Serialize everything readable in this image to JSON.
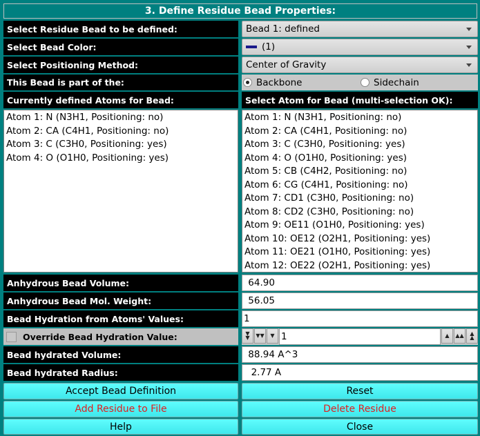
{
  "title": "3. Define Residue Bead Properties:",
  "rows": {
    "select_bead": {
      "label": "Select Residue Bead to be defined:",
      "value": "Bead 1: defined"
    },
    "select_color": {
      "label": "Select Bead Color:",
      "value": "(1)",
      "swatch_color": "#1a1a8a"
    },
    "select_positioning": {
      "label": "Select Positioning Method:",
      "value": "Center of Gravity"
    },
    "part_of": {
      "label": "This Bead is part of the:",
      "options": [
        "Backbone",
        "Sidechain"
      ],
      "selected": "Backbone"
    }
  },
  "defined_atoms": {
    "header": "Currently defined Atoms for Bead:",
    "items": [
      "Atom 1: N (N3H1, Positioning: no)",
      "Atom 2: CA (C4H1, Positioning: no)",
      "Atom 3: C (C3H0, Positioning: yes)",
      "Atom 4: O (O1H0, Positioning: yes)"
    ]
  },
  "select_atoms": {
    "header": "Select Atom for Bead (multi-selection OK):",
    "items": [
      "Atom 1: N (N3H1, Positioning: no)",
      "Atom 2: CA (C4H1, Positioning: no)",
      "Atom 3: C (C3H0, Positioning: yes)",
      "Atom 4: O (O1H0, Positioning: yes)",
      "Atom 5: CB (C4H2, Positioning: no)",
      "Atom 6: CG (C4H1, Positioning: no)",
      "Atom 7: CD1 (C3H0, Positioning: no)",
      "Atom 8: CD2 (C3H0, Positioning: no)",
      "Atom 9: OE11 (O1H0, Positioning: yes)",
      "Atom 10: OE12 (O2H1, Positioning: yes)",
      "Atom 11: OE21 (O1H0, Positioning: yes)",
      "Atom 12: OE22 (O2H1, Positioning: yes)"
    ]
  },
  "properties": {
    "anhydrous_volume": {
      "label": "Anhydrous Bead Volume:",
      "value": " 64.90"
    },
    "anhydrous_mw": {
      "label": "Anhydrous Bead Mol. Weight:",
      "value": " 56.05"
    },
    "hydration_atoms": {
      "label": "Bead Hydration from Atoms' Values:",
      "value": "1"
    },
    "override_hydration": {
      "label": "Override Bead Hydration Value:",
      "value": "1",
      "checked": false
    },
    "hydrated_volume": {
      "label": "Bead hydrated Volume:",
      "value": " 88.94 A^3"
    },
    "hydrated_radius": {
      "label": "Bead hydrated Radius:",
      "value": "  2.77 A"
    }
  },
  "buttons": {
    "accept": "Accept Bead Definition",
    "reset": "Reset",
    "add_residue": "Add Residue to File",
    "delete_residue": "Delete Residue",
    "help": "Help",
    "close": "Close"
  }
}
